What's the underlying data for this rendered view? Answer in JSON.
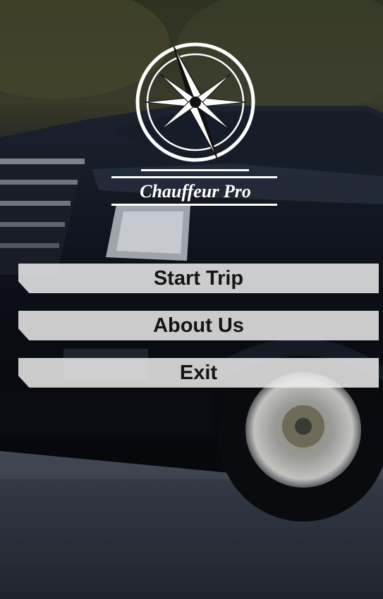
{
  "app": {
    "brand_name": "Chauffeur Pro",
    "logo_icon": "compass-rose-icon"
  },
  "menu": {
    "items": [
      {
        "label": "Start Trip"
      },
      {
        "label": "About Us"
      },
      {
        "label": "Exit"
      }
    ]
  },
  "colors": {
    "button_bg": "#ebebeb",
    "button_text": "#151515",
    "logo": "#ffffff"
  }
}
